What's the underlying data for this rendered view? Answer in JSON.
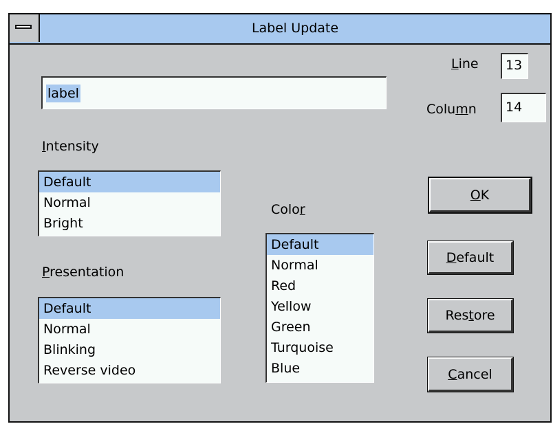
{
  "dialog": {
    "title": "Label Update"
  },
  "label_field": {
    "value": "label"
  },
  "line": {
    "pre": "",
    "u": "L",
    "post": "ine",
    "value": "13"
  },
  "column": {
    "pre": "Colu",
    "u": "m",
    "post": "n",
    "value": "14"
  },
  "intensity": {
    "label": {
      "pre": "",
      "u": "I",
      "post": "ntensity"
    },
    "items": [
      "Default",
      "Normal",
      "Bright"
    ],
    "selected": "Default"
  },
  "presentation": {
    "label": {
      "pre": "",
      "u": "P",
      "post": "resentation"
    },
    "items": [
      "Default",
      "Normal",
      "Blinking",
      "Reverse video"
    ],
    "selected": "Default"
  },
  "color": {
    "label": {
      "pre": "Colo",
      "u": "r",
      "post": ""
    },
    "items": [
      "Default",
      "Normal",
      "Red",
      "Yellow",
      "Green",
      "Turquoise",
      "Blue"
    ],
    "selected": "Default"
  },
  "buttons": {
    "ok": {
      "pre": "",
      "u": "O",
      "post": "K"
    },
    "default": {
      "pre": "",
      "u": "D",
      "post": "efault"
    },
    "restore": {
      "pre": "Res",
      "u": "t",
      "post": "ore"
    },
    "cancel": {
      "pre": "",
      "u": "C",
      "post": "ancel"
    }
  },
  "colors": {
    "dialog_bg": "#c7c9cb",
    "titlebar": "#a8c9ef",
    "selection": "#a8c9ef",
    "field_bg": "#f6fbf9"
  }
}
